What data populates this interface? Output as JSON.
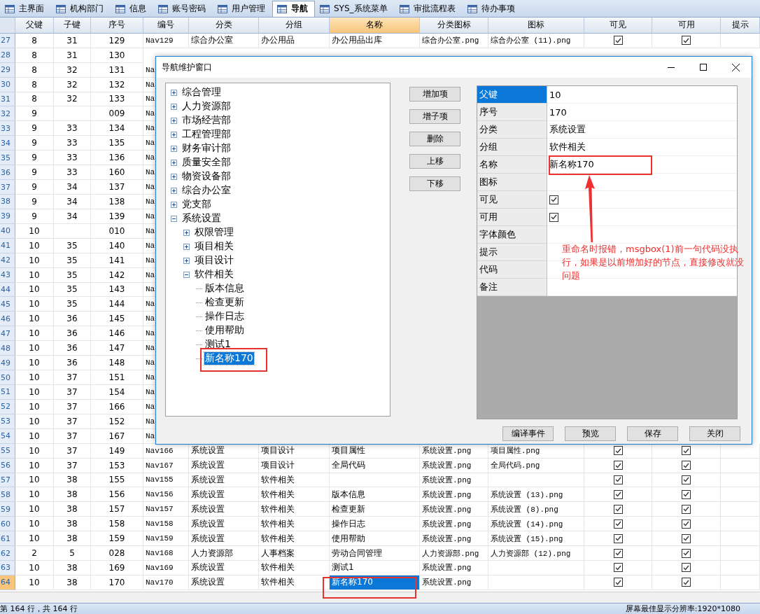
{
  "tabs": [
    {
      "label": "主界面",
      "selected": false
    },
    {
      "label": "机构部门",
      "selected": false
    },
    {
      "label": "信息",
      "selected": false
    },
    {
      "label": "账号密码",
      "selected": false
    },
    {
      "label": "用户管理",
      "selected": false
    },
    {
      "label": "导航",
      "selected": true
    },
    {
      "label": "SYS_系统菜单",
      "selected": false
    },
    {
      "label": "审批流程表",
      "selected": false
    },
    {
      "label": "待办事项",
      "selected": false
    }
  ],
  "table": {
    "columns": [
      {
        "label": "父键",
        "selected": false
      },
      {
        "label": "子键",
        "selected": false
      },
      {
        "label": "序号",
        "selected": false
      },
      {
        "label": "编号",
        "selected": false
      },
      {
        "label": "分类",
        "selected": false
      },
      {
        "label": "分组",
        "selected": false
      },
      {
        "label": "名称",
        "selected": true
      },
      {
        "label": "分类图标",
        "selected": false
      },
      {
        "label": "图标",
        "selected": false
      },
      {
        "label": "可见",
        "selected": false
      },
      {
        "label": "可用",
        "selected": false
      },
      {
        "label": "提示",
        "selected": false
      }
    ],
    "rows": [
      {
        "num": "27",
        "selected": false,
        "cells": [
          "8",
          "31",
          "129",
          "Nav129",
          "综合办公室",
          "办公用品",
          "办公用品出库",
          "综合办公室.png",
          "综合办公室 (11).png"
        ],
        "visible": true,
        "enabled": true
      },
      {
        "num": "28",
        "selected": false,
        "cells": [
          "8",
          "31",
          "130"
        ]
      },
      {
        "num": "29",
        "selected": false,
        "cells": [
          "8",
          "32",
          "131",
          "Na"
        ]
      },
      {
        "num": "30",
        "selected": false,
        "cells": [
          "8",
          "32",
          "132",
          "Na"
        ]
      },
      {
        "num": "31",
        "selected": false,
        "cells": [
          "8",
          "32",
          "133",
          "Na"
        ]
      },
      {
        "num": "32",
        "selected": false,
        "cells": [
          "9",
          "",
          "009",
          "Na"
        ]
      },
      {
        "num": "33",
        "selected": false,
        "cells": [
          "9",
          "33",
          "134",
          "Na"
        ]
      },
      {
        "num": "34",
        "selected": false,
        "cells": [
          "9",
          "33",
          "135",
          "Na"
        ]
      },
      {
        "num": "35",
        "selected": false,
        "cells": [
          "9",
          "33",
          "136",
          "Na"
        ]
      },
      {
        "num": "36",
        "selected": false,
        "cells": [
          "9",
          "33",
          "160",
          "Na"
        ]
      },
      {
        "num": "37",
        "selected": false,
        "cells": [
          "9",
          "34",
          "137",
          "Na"
        ]
      },
      {
        "num": "38",
        "selected": false,
        "cells": [
          "9",
          "34",
          "138",
          "Na"
        ]
      },
      {
        "num": "39",
        "selected": false,
        "cells": [
          "9",
          "34",
          "139",
          "Na"
        ]
      },
      {
        "num": "40",
        "selected": false,
        "cells": [
          "10",
          "",
          "010",
          "Na"
        ]
      },
      {
        "num": "41",
        "selected": false,
        "cells": [
          "10",
          "35",
          "140",
          "Na"
        ]
      },
      {
        "num": "42",
        "selected": false,
        "cells": [
          "10",
          "35",
          "141",
          "Na"
        ]
      },
      {
        "num": "43",
        "selected": false,
        "cells": [
          "10",
          "35",
          "142",
          "Na"
        ]
      },
      {
        "num": "44",
        "selected": false,
        "cells": [
          "10",
          "35",
          "143",
          "Na"
        ]
      },
      {
        "num": "45",
        "selected": false,
        "cells": [
          "10",
          "35",
          "144",
          "Na"
        ]
      },
      {
        "num": "46",
        "selected": false,
        "cells": [
          "10",
          "36",
          "145",
          "Na"
        ]
      },
      {
        "num": "47",
        "selected": false,
        "cells": [
          "10",
          "36",
          "146",
          "Na"
        ]
      },
      {
        "num": "48",
        "selected": false,
        "cells": [
          "10",
          "36",
          "147",
          "Na"
        ]
      },
      {
        "num": "49",
        "selected": false,
        "cells": [
          "10",
          "36",
          "148",
          "Na"
        ]
      },
      {
        "num": "50",
        "selected": false,
        "cells": [
          "10",
          "37",
          "151",
          "Na"
        ]
      },
      {
        "num": "51",
        "selected": false,
        "cells": [
          "10",
          "37",
          "154",
          "Na"
        ]
      },
      {
        "num": "52",
        "selected": false,
        "cells": [
          "10",
          "37",
          "166",
          "Na"
        ]
      },
      {
        "num": "53",
        "selected": false,
        "cells": [
          "10",
          "37",
          "152",
          "Na"
        ]
      },
      {
        "num": "54",
        "selected": false,
        "cells": [
          "10",
          "37",
          "167",
          "Na"
        ]
      },
      {
        "num": "55",
        "selected": false,
        "cells": [
          "10",
          "37",
          "149",
          "Nav166",
          "系统设置",
          "项目设计",
          "项目属性",
          "系统设置.png",
          "项目属性.png"
        ],
        "visible": true,
        "enabled": true
      },
      {
        "num": "56",
        "selected": false,
        "cells": [
          "10",
          "37",
          "153",
          "Nav167",
          "系统设置",
          "项目设计",
          "全局代码",
          "系统设置.png",
          "全局代码.png"
        ],
        "visible": true,
        "enabled": true
      },
      {
        "num": "57",
        "selected": false,
        "cells": [
          "10",
          "38",
          "155",
          "Nav155",
          "系统设置",
          "软件相关",
          "",
          "系统设置.png",
          ""
        ],
        "visible": true,
        "enabled": true
      },
      {
        "num": "58",
        "selected": false,
        "cells": [
          "10",
          "38",
          "156",
          "Nav156",
          "系统设置",
          "软件相关",
          "版本信息",
          "系统设置.png",
          "系统设置 (13).png"
        ],
        "visible": true,
        "enabled": true
      },
      {
        "num": "59",
        "selected": false,
        "cells": [
          "10",
          "38",
          "157",
          "Nav157",
          "系统设置",
          "软件相关",
          "检查更新",
          "系统设置.png",
          "系统设置 (8).png"
        ],
        "visible": true,
        "enabled": true
      },
      {
        "num": "60",
        "selected": false,
        "cells": [
          "10",
          "38",
          "158",
          "Nav158",
          "系统设置",
          "软件相关",
          "操作日志",
          "系统设置.png",
          "系统设置 (14).png"
        ],
        "visible": true,
        "enabled": true
      },
      {
        "num": "61",
        "selected": false,
        "cells": [
          "10",
          "38",
          "159",
          "Nav159",
          "系统设置",
          "软件相关",
          "使用帮助",
          "系统设置.png",
          "系统设置 (15).png"
        ],
        "visible": true,
        "enabled": true
      },
      {
        "num": "62",
        "selected": false,
        "cells": [
          "2",
          "5",
          "028",
          "Nav168",
          "人力资源部",
          "人事档案",
          "劳动合同管理",
          "人力资源部.png",
          "人力资源部 (12).png"
        ],
        "visible": true,
        "enabled": true
      },
      {
        "num": "63",
        "selected": false,
        "cells": [
          "10",
          "38",
          "169",
          "Nav169",
          "系统设置",
          "软件相关",
          "测试1",
          "系统设置.png",
          ""
        ],
        "visible": true,
        "enabled": true
      },
      {
        "num": "64",
        "selected": true,
        "cells": [
          "10",
          "38",
          "170",
          "Nav170",
          "系统设置",
          "软件相关",
          "新名称170",
          "系统设置.png",
          ""
        ],
        "visible": true,
        "enabled": true
      }
    ]
  },
  "status_bar": {
    "left": "第 164 行，共 164 行",
    "right": "屏幕最佳显示分辨率:1920*1080"
  },
  "dialog": {
    "title": "导航维护窗口",
    "tree": [
      {
        "label": "综合管理",
        "kind": "branch",
        "expanded": false,
        "selected": false
      },
      {
        "label": "人力资源部",
        "kind": "branch",
        "expanded": false,
        "selected": false
      },
      {
        "label": "市场经营部",
        "kind": "branch",
        "expanded": false,
        "selected": false
      },
      {
        "label": "工程管理部",
        "kind": "branch",
        "expanded": false,
        "selected": false
      },
      {
        "label": "财务审计部",
        "kind": "branch",
        "expanded": false,
        "selected": false
      },
      {
        "label": "质量安全部",
        "kind": "branch",
        "expanded": false,
        "selected": false
      },
      {
        "label": "物资设备部",
        "kind": "branch",
        "expanded": false,
        "selected": false
      },
      {
        "label": "综合办公室",
        "kind": "branch",
        "expanded": false,
        "selected": false
      },
      {
        "label": "党支部",
        "kind": "branch",
        "expanded": false,
        "selected": false
      },
      {
        "label": "系统设置",
        "kind": "branch",
        "expanded": true,
        "selected": false,
        "children": [
          {
            "label": "权限管理",
            "kind": "branch",
            "expanded": false,
            "selected": false
          },
          {
            "label": "项目相关",
            "kind": "branch",
            "expanded": false,
            "selected": false
          },
          {
            "label": "项目设计",
            "kind": "branch",
            "expanded": false,
            "selected": false
          },
          {
            "label": "软件相关",
            "kind": "branch",
            "expanded": true,
            "selected": false,
            "children": [
              {
                "label": "版本信息",
                "kind": "leaf",
                "selected": false
              },
              {
                "label": "检查更新",
                "kind": "leaf",
                "selected": false
              },
              {
                "label": "操作日志",
                "kind": "leaf",
                "selected": false
              },
              {
                "label": "使用帮助",
                "kind": "leaf",
                "selected": false
              },
              {
                "label": "测试1",
                "kind": "leaf",
                "selected": false
              },
              {
                "label": "新名称170",
                "kind": "leaf",
                "selected": true
              }
            ]
          }
        ]
      }
    ],
    "actions": [
      "增加项",
      "增子项",
      "删除",
      "上移",
      "下移"
    ],
    "properties": [
      {
        "label": "父键",
        "kind": "text",
        "value": "10",
        "selected": true
      },
      {
        "label": "序号",
        "kind": "text",
        "value": "170",
        "selected": false
      },
      {
        "label": "分类",
        "kind": "text",
        "value": "系统设置",
        "selected": false
      },
      {
        "label": "分组",
        "kind": "text",
        "value": "软件相关",
        "selected": false
      },
      {
        "label": "名称",
        "kind": "text",
        "value": "新名称170",
        "selected": false
      },
      {
        "label": "图标",
        "kind": "text",
        "selected": false
      },
      {
        "label": "可见",
        "kind": "checkbox",
        "checked": true,
        "selected": false
      },
      {
        "label": "可用",
        "kind": "checkbox",
        "checked": true,
        "selected": false
      },
      {
        "label": "字体颜色",
        "kind": "text",
        "selected": false
      },
      {
        "label": "提示",
        "kind": "text",
        "selected": false
      },
      {
        "label": "代码",
        "kind": "text",
        "selected": false
      },
      {
        "label": "备注",
        "kind": "text",
        "selected": false
      }
    ],
    "footer_buttons": [
      "编译事件",
      "预览",
      "保存",
      "关闭"
    ]
  },
  "annotation": {
    "text": "重命名时报错，msgbox(1)前一句代码没执行，如果是以前增加好的节点，直接修改就没问题"
  }
}
